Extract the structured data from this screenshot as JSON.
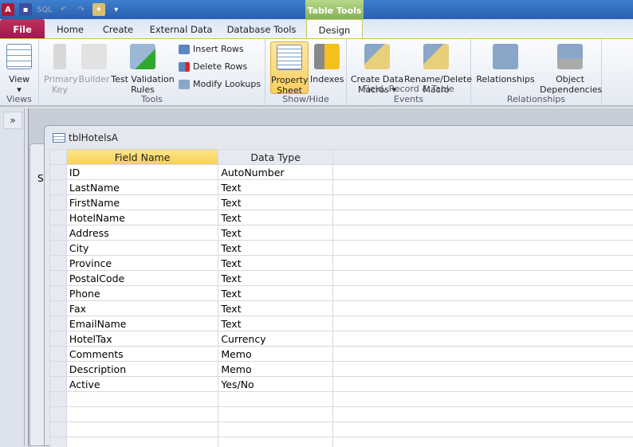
{
  "quick_access": {
    "sql_label": "SQL"
  },
  "ribbon": {
    "context_tab": "Table Tools",
    "tabs": [
      "File",
      "Home",
      "Create",
      "External Data",
      "Database Tools",
      "Design"
    ],
    "active_tab": "Design",
    "groups": {
      "views": {
        "label": "Views",
        "view": "View"
      },
      "tools": {
        "label": "Tools",
        "primary_key_1": "Primary",
        "primary_key_2": "Key",
        "builder": "Builder",
        "test_validation_1": "Test Validation",
        "test_validation_2": "Rules",
        "insert_rows": "Insert Rows",
        "delete_rows": "Delete Rows",
        "modify_lookups": "Modify Lookups"
      },
      "show_hide": {
        "label": "Show/Hide",
        "property_sheet_1": "Property",
        "property_sheet_2": "Sheet",
        "indexes": "Indexes"
      },
      "events": {
        "label": "Field, Record & Table Events",
        "create_data_macros_1": "Create Data",
        "create_data_macros_2": "Macros ▾",
        "rename_delete_1": "Rename/Delete",
        "rename_delete_2": "Macro"
      },
      "relationships": {
        "label": "Relationships",
        "relationships": "Relationships",
        "object_dependencies_1": "Object",
        "object_dependencies_2": "Dependencies"
      }
    }
  },
  "nav": {
    "toggle": "»"
  },
  "back_window": {
    "partial_text": "S"
  },
  "table": {
    "title": "tblHotelsA",
    "columns": [
      "Field Name",
      "Data Type",
      ""
    ],
    "rows": [
      [
        "ID",
        "AutoNumber"
      ],
      [
        "LastName",
        "Text"
      ],
      [
        "FirstName",
        "Text"
      ],
      [
        "HotelName",
        "Text"
      ],
      [
        "Address",
        "Text"
      ],
      [
        "City",
        "Text"
      ],
      [
        "Province",
        "Text"
      ],
      [
        "PostalCode",
        "Text"
      ],
      [
        "Phone",
        "Text"
      ],
      [
        "Fax",
        "Text"
      ],
      [
        "EmailName",
        "Text"
      ],
      [
        "HotelTax",
        "Currency"
      ],
      [
        "Comments",
        "Memo"
      ],
      [
        "Description",
        "Memo"
      ],
      [
        "Active",
        "Yes/No"
      ]
    ]
  }
}
